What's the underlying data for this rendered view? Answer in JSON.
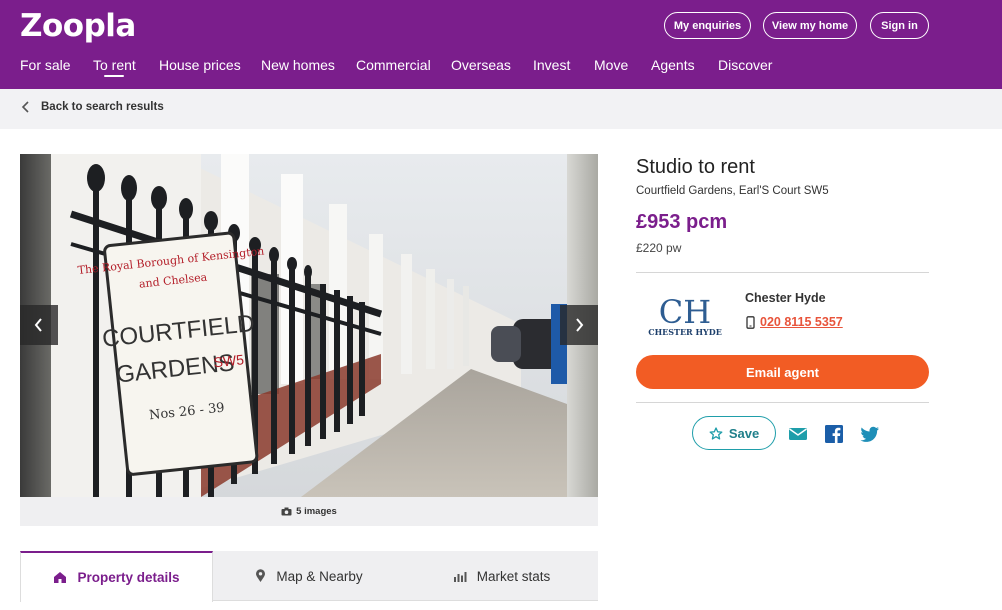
{
  "header": {
    "logo": "Zoopla",
    "buttons": [
      "My enquiries",
      "View my home",
      "Sign in"
    ],
    "nav": [
      "For sale",
      "To rent",
      "House prices",
      "New homes",
      "Commercial",
      "Overseas",
      "Invest",
      "Move",
      "Agents",
      "Discover"
    ],
    "active_nav": "To rent",
    "brand_color": "#7b1e8c"
  },
  "breadcrumb": {
    "back_label": "Back to search results"
  },
  "gallery": {
    "image_count_label": "5 images",
    "icons": [
      "camera-icon",
      "chevron-left-icon",
      "chevron-right-icon"
    ]
  },
  "tabs": [
    {
      "label": "Property details",
      "icon": "home-icon",
      "active": true
    },
    {
      "label": "Map & Nearby",
      "icon": "map-pin-icon",
      "active": false
    },
    {
      "label": "Market stats",
      "icon": "bar-chart-icon",
      "active": false
    }
  ],
  "listing": {
    "title": "Studio to rent",
    "address": "Courtfield Gardens, Earl'S Court SW5",
    "price_pcm": "£953 pcm",
    "price_pw": "£220 pw"
  },
  "agent": {
    "logo_text": "CH",
    "logo_caption": "CHESTER HYDE",
    "name": "Chester Hyde",
    "phone": "020 8115 5357",
    "email_button": "Email agent"
  },
  "actions": {
    "save_label": "Save",
    "share_icons": [
      "envelope-icon",
      "facebook-icon",
      "twitter-icon"
    ],
    "accent_color": "#f25c24",
    "teal_color": "#1f9eaa"
  },
  "photo_sign": {
    "line1": "The Royal Borough of Kensington",
    "line2": "and Chelsea",
    "line3": "COURTFIELD",
    "line4": "GARDENS",
    "line4_code": "SW5",
    "line5": "Nos 26 - 39"
  }
}
